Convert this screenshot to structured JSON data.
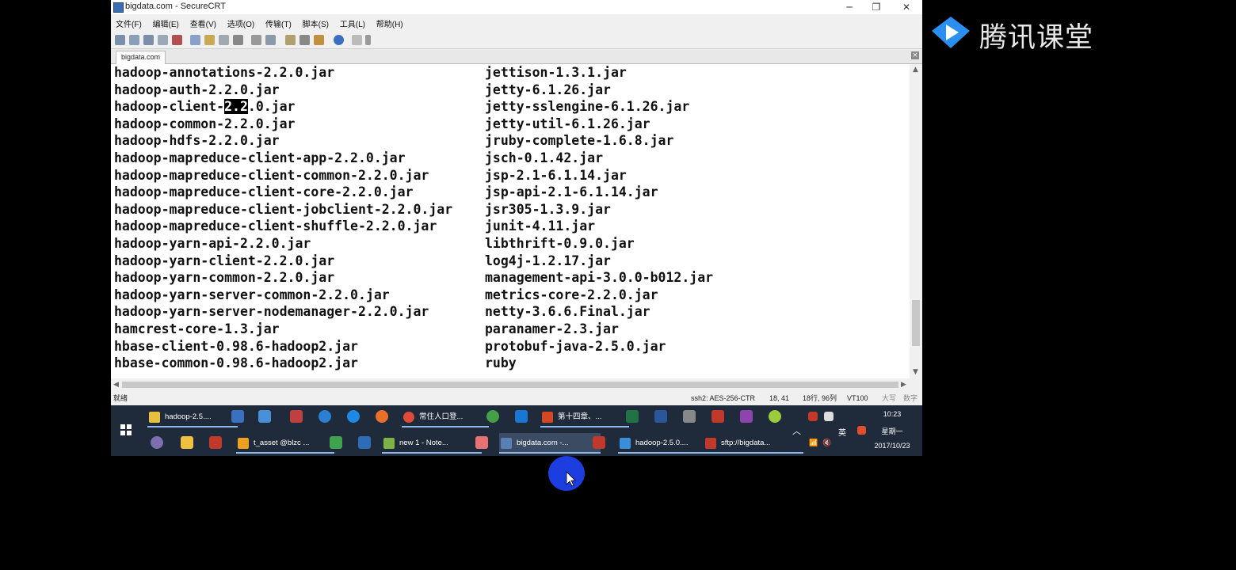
{
  "window": {
    "title": "bigdata.com - SecureCRT",
    "controls": {
      "minimize": "─",
      "restore": "❐",
      "close": "✕"
    }
  },
  "menu": [
    "文件(F)",
    "编辑(E)",
    "查看(V)",
    "选项(O)",
    "传输(T)",
    "脚本(S)",
    "工具(L)",
    "帮助(H)"
  ],
  "tab": {
    "label": "bigdata.com",
    "close": "×"
  },
  "terminal": {
    "left_lines": [
      "hadoop-annotations-2.2.0.jar",
      "hadoop-auth-2.2.0.jar",
      "hadoop-client-",
      "hadoop-common-2.2.0.jar",
      "hadoop-hdfs-2.2.0.jar",
      "hadoop-mapreduce-client-app-2.2.0.jar",
      "hadoop-mapreduce-client-common-2.2.0.jar",
      "hadoop-mapreduce-client-core-2.2.0.jar",
      "hadoop-mapreduce-client-jobclient-2.2.0.jar",
      "hadoop-mapreduce-client-shuffle-2.2.0.jar",
      "hadoop-yarn-api-2.2.0.jar",
      "hadoop-yarn-client-2.2.0.jar",
      "hadoop-yarn-common-2.2.0.jar",
      "hadoop-yarn-server-common-2.2.0.jar",
      "hadoop-yarn-server-nodemanager-2.2.0.jar",
      "hamcrest-core-1.3.jar",
      "hbase-client-0.98.6-hadoop2.jar",
      "hbase-common-0.98.6-hadoop2.jar"
    ],
    "selection": {
      "text": "2.2",
      "after": ".0.jar"
    },
    "right_lines": [
      "jettison-1.3.1.jar",
      "jetty-6.1.26.jar",
      "jetty-sslengine-6.1.26.jar",
      "jetty-util-6.1.26.jar",
      "jruby-complete-1.6.8.jar",
      "jsch-0.1.42.jar",
      "jsp-2.1-6.1.14.jar",
      "jsp-api-2.1-6.1.14.jar",
      "jsr305-1.3.9.jar",
      "junit-4.11.jar",
      "libthrift-0.9.0.jar",
      "log4j-1.2.17.jar",
      "management-api-3.0.0-b012.jar",
      "metrics-core-2.2.0.jar",
      "netty-3.6.6.Final.jar",
      "paranamer-2.3.jar",
      "protobuf-java-2.5.0.jar",
      "ruby"
    ]
  },
  "status": {
    "ready": "就绪",
    "ssh": "ssh2: AES-256-CTR",
    "cursor": "18,  41",
    "rows_cols": "18行, 96列",
    "term": "VT100",
    "caps": "大写",
    "num": "数字"
  },
  "taskbar": {
    "row1": [
      {
        "label": "hadoop-2.5....",
        "color": "#e8c040"
      },
      {
        "label": "常住人口登...",
        "color": "#e04a3a"
      },
      {
        "label": "第十四章、...",
        "color": "#d24726"
      }
    ],
    "row2": [
      {
        "label": "t_asset @blzc ...",
        "color": "#f0a020"
      },
      {
        "label": "new  1 - Note...",
        "color": "#7cb342"
      },
      {
        "label": "bigdata.com -...",
        "color": "#5a7fb5"
      },
      {
        "label": "hadoop-2.5.0....",
        "color": "#3a8fd8"
      },
      {
        "label": "sftp://bigdata...",
        "color": "#c0392b"
      }
    ],
    "ime": "英",
    "time": "10:23",
    "weekday": "星期一",
    "date": "2017/10/23"
  },
  "watermark": {
    "text": "腾讯课堂",
    "color": "#2a8ff0"
  },
  "colors": {
    "terminal_bg": "#ffffff",
    "taskbar": "#1f2a3a",
    "cursor_dot": "#1c3de0"
  }
}
